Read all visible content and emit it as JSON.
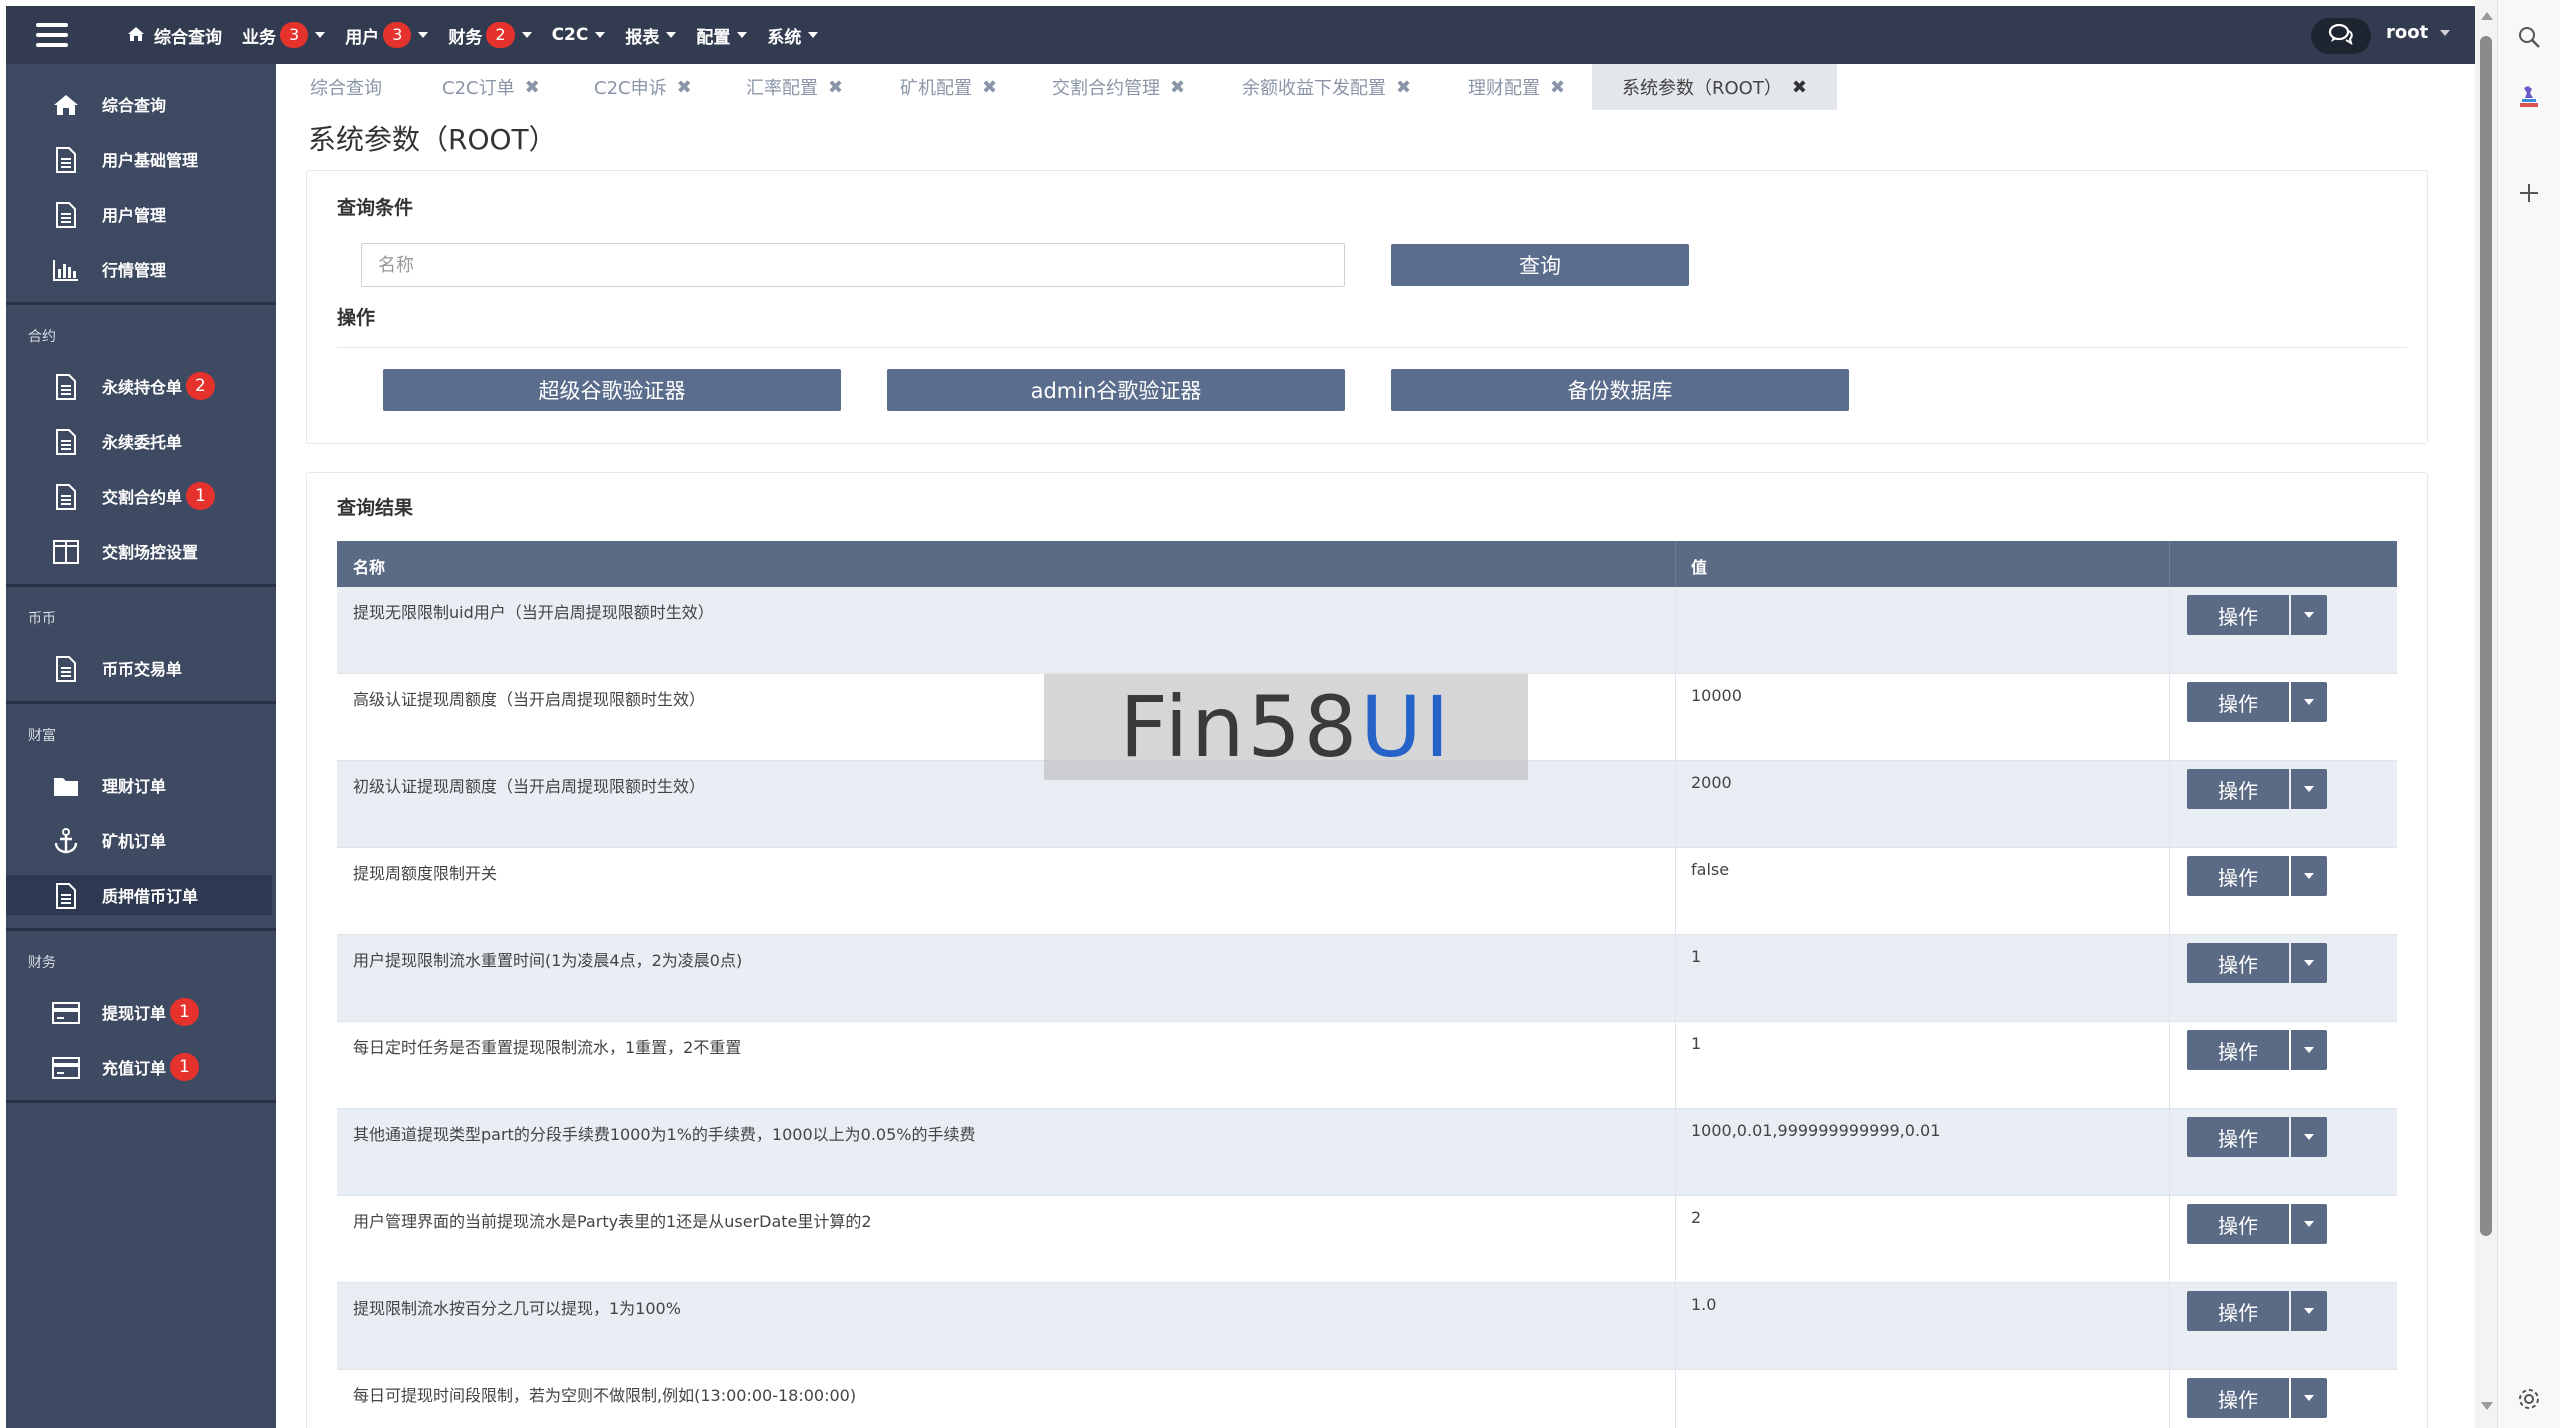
{
  "topbar": {
    "nav": [
      {
        "label": "综合查询",
        "badge": null,
        "icon": "home-icon",
        "dropdown": false
      },
      {
        "label": "业务",
        "badge": "3",
        "dropdown": true
      },
      {
        "label": "用户",
        "badge": "3",
        "dropdown": true
      },
      {
        "label": "财务",
        "badge": "2",
        "dropdown": true
      },
      {
        "label": "C2C",
        "badge": null,
        "dropdown": true
      },
      {
        "label": "报表",
        "badge": null,
        "dropdown": true
      },
      {
        "label": "配置",
        "badge": null,
        "dropdown": true
      },
      {
        "label": "系统",
        "badge": null,
        "dropdown": true
      }
    ],
    "user": "root"
  },
  "sidebar": {
    "items": [
      {
        "label": "综合查询",
        "icon": "home-icon"
      },
      {
        "label": "用户基础管理",
        "icon": "document-icon"
      },
      {
        "label": "用户管理",
        "icon": "document-icon"
      },
      {
        "label": "行情管理",
        "icon": "bar-chart-icon"
      }
    ],
    "sections": [
      {
        "title": "合约",
        "items": [
          {
            "label": "永续持仓单",
            "icon": "document-icon",
            "badge": "2"
          },
          {
            "label": "永续委托单",
            "icon": "document-icon",
            "badge": null
          },
          {
            "label": "交割合约单",
            "icon": "document-icon",
            "badge": "1"
          },
          {
            "label": "交割场控设置",
            "icon": "columns-icon",
            "badge": null
          }
        ]
      },
      {
        "title": "币币",
        "items": [
          {
            "label": "币币交易单",
            "icon": "document-icon",
            "badge": null
          }
        ]
      },
      {
        "title": "财富",
        "items": [
          {
            "label": "理财订单",
            "icon": "folder-icon",
            "badge": null
          },
          {
            "label": "矿机订单",
            "icon": "anchor-icon",
            "badge": null
          },
          {
            "label": "质押借币订单",
            "icon": "document-icon",
            "badge": null,
            "active": true
          }
        ]
      },
      {
        "title": "财务",
        "items": [
          {
            "label": "提现订单",
            "icon": "credit-card-icon",
            "badge": "1"
          },
          {
            "label": "充值订单",
            "icon": "credit-card-icon",
            "badge": "1"
          }
        ]
      }
    ]
  },
  "tabs": [
    {
      "label": "综合查询",
      "closable": false
    },
    {
      "label": "C2C订单",
      "closable": true
    },
    {
      "label": "C2C申诉",
      "closable": true
    },
    {
      "label": "汇率配置",
      "closable": true
    },
    {
      "label": "矿机配置",
      "closable": true
    },
    {
      "label": "交割合约管理",
      "closable": true
    },
    {
      "label": "余额收益下发配置",
      "closable": true
    },
    {
      "label": "理财配置",
      "closable": true
    },
    {
      "label": "系统参数（ROOT）",
      "closable": true,
      "active": true
    }
  ],
  "page": {
    "title": "系统参数（ROOT）"
  },
  "query": {
    "heading": "查询条件",
    "name_placeholder": "名称",
    "name_value": "",
    "search_label": "查询",
    "ops_heading": "操作",
    "actions": [
      "超级谷歌验证器",
      "admin谷歌验证器",
      "备份数据库"
    ]
  },
  "results": {
    "heading": "查询结果",
    "columns": [
      "名称",
      "值"
    ],
    "op_label": "操作",
    "rows": [
      {
        "name": "提现无限限制uid用户（当开启周提现限额时生效）",
        "value": ""
      },
      {
        "name": "高级认证提现周额度（当开启周提现限额时生效）",
        "value": "10000"
      },
      {
        "name": "初级认证提现周额度（当开启周提现限额时生效）",
        "value": "2000"
      },
      {
        "name": "提现周额度限制开关",
        "value": "false"
      },
      {
        "name": "用户提现限制流水重置时间(1为凌晨4点，2为凌晨0点)",
        "value": "1"
      },
      {
        "name": "每日定时任务是否重置提现限制流水，1重置，2不重置",
        "value": "1"
      },
      {
        "name": "其他通道提现类型part的分段手续费1000为1%的手续费，1000以上为0.05%的手续费",
        "value": "1000,0.01,999999999999,0.01"
      },
      {
        "name": "用户管理界面的当前提现流水是Party表里的1还是从userDate里计算的2",
        "value": "2"
      },
      {
        "name": "提现限制流水按百分之几可以提现，1为100%",
        "value": "1.0"
      },
      {
        "name": "每日可提现时间段限制，若为空则不做限制,例如(13:00:00-18:00:00)",
        "value": ""
      }
    ]
  },
  "watermark": {
    "part1": "Fin58",
    "part2": "UI"
  },
  "colors": {
    "topbar": "#323b4f",
    "sidebar": "#3e4a62",
    "button": "#5b6b85",
    "badge": "#e5322d",
    "accent": "#2563c9"
  }
}
